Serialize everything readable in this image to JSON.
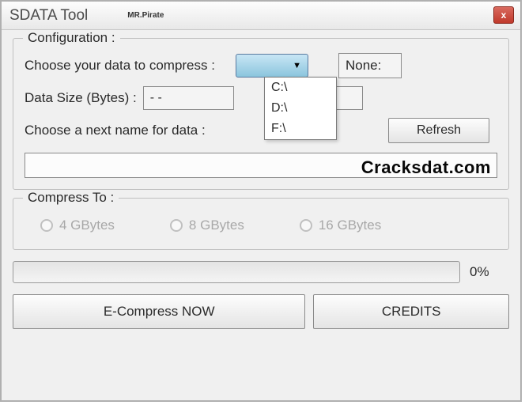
{
  "title": {
    "main": "SDATA Tool",
    "sub": "MR.Pirate"
  },
  "close_icon": "x",
  "config": {
    "group_title": "Configuration :",
    "choose_label": "Choose your data to compress :",
    "none_label": "None:",
    "drives": [
      "C:\\",
      "D:\\",
      "F:\\"
    ],
    "data_size_label": "Data Size (Bytes) :",
    "data_size_value": "- -",
    "partial_label_r": ") :",
    "partial_value": "- -",
    "choose_name_label": "Choose a next name for data :",
    "refresh_label": "Refresh",
    "name_value": ""
  },
  "compress": {
    "group_title": "Compress To :",
    "options": [
      "4 GBytes",
      "8 GBytes",
      "16 GBytes"
    ]
  },
  "progress": {
    "percent_label": "0%"
  },
  "buttons": {
    "ecompress": "E-Compress NOW",
    "credits": "CREDITS"
  },
  "watermark": "Cracksdat.com"
}
